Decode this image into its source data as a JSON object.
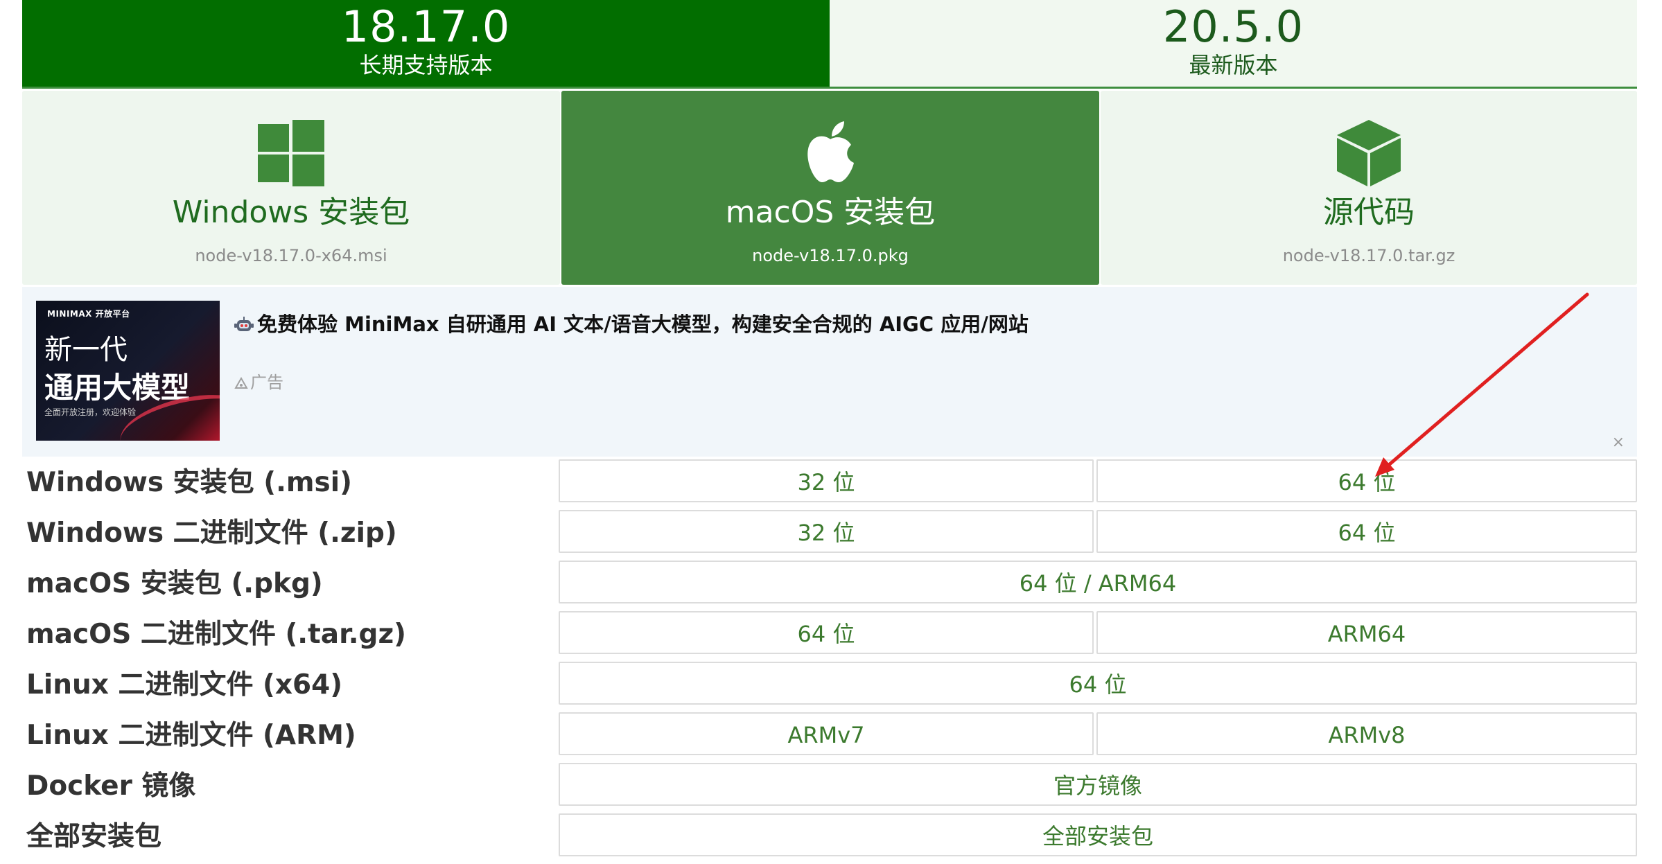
{
  "version_tabs": {
    "lts": {
      "version": "18.17.0",
      "label": "长期支持版本"
    },
    "current": {
      "version": "20.5.0",
      "label": "最新版本"
    }
  },
  "download_cards": {
    "windows": {
      "title": "Windows 安装包",
      "filename": "node-v18.17.0-x64.msi",
      "icon": "windows-icon"
    },
    "macos": {
      "title": "macOS 安装包",
      "filename": "node-v18.17.0.pkg",
      "icon": "apple-icon"
    },
    "source": {
      "title": "源代码",
      "filename": "node-v18.17.0.tar.gz",
      "icon": "cube-icon"
    }
  },
  "ad": {
    "image": {
      "brand": "MINIMAX 开放平台",
      "line1": "新一代",
      "line2": "通用大模型",
      "line3": "全面开放注册，欢迎体验"
    },
    "headline": "免费体验 MiniMax 自研通用 AI 文本/语音大模型，构建安全合规的 AIGC 应用/网站",
    "label": "广告",
    "close": "×"
  },
  "downloads_table": {
    "rows": [
      {
        "label": "Windows 安装包 (.msi)",
        "buttons": [
          "32 位",
          "64 位"
        ]
      },
      {
        "label": "Windows 二进制文件 (.zip)",
        "buttons": [
          "32 位",
          "64 位"
        ]
      },
      {
        "label": "macOS 安装包 (.pkg)",
        "buttons": [
          "64 位 / ARM64"
        ]
      },
      {
        "label": "macOS 二进制文件 (.tar.gz)",
        "buttons": [
          "64 位",
          "ARM64"
        ]
      },
      {
        "label": "Linux 二进制文件 (x64)",
        "buttons": [
          "64 位"
        ]
      },
      {
        "label": "Linux 二进制文件 (ARM)",
        "buttons": [
          "ARMv7",
          "ARMv8"
        ]
      },
      {
        "label": "Docker 镜像",
        "buttons": [
          "官方镜像"
        ]
      },
      {
        "label": "全部安装包",
        "buttons": [
          "全部安装包"
        ]
      }
    ]
  },
  "colors": {
    "brand_green": "#026e00",
    "card_green": "#44873f",
    "light_green_bg": "#eef6ee",
    "button_text": "#3c7a2e",
    "annotation_red": "#e02020"
  }
}
